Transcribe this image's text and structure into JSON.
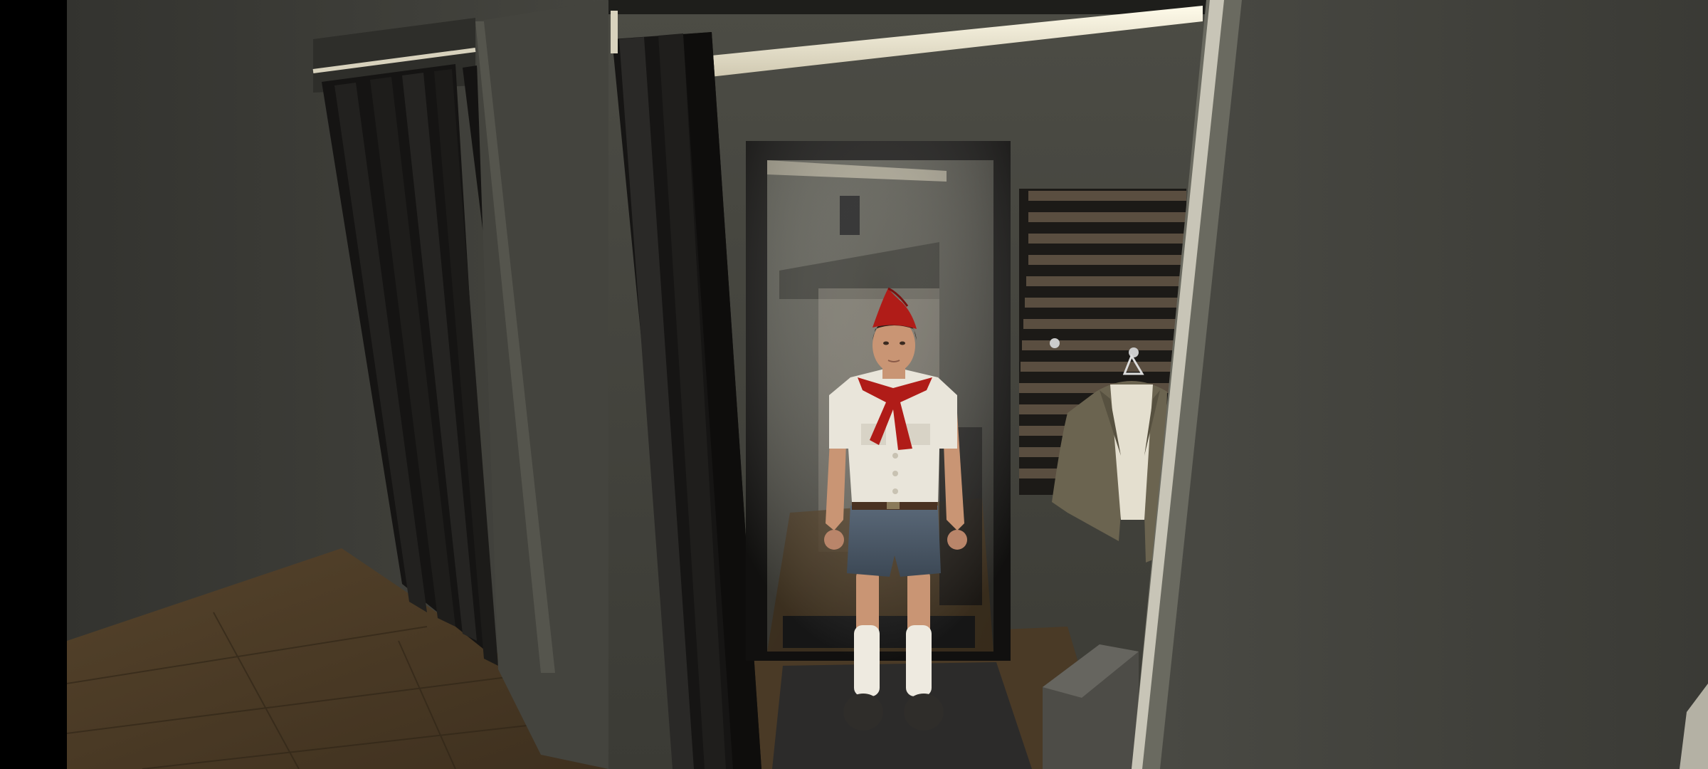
{
  "screen": {
    "type": "game-3d-scene",
    "location": "fitting-room",
    "hud_text": []
  },
  "colors": {
    "wall": "#3d3d38",
    "wall_dark": "#2a2a26",
    "floor_wood": "#4a3a26",
    "curtain": "#1a1918",
    "rail": "#e8e2cc",
    "mirror_frame": "#1d1c1a",
    "scarf_red": "#b01c18",
    "shirt": "#e9e5da",
    "shorts": "#4e5c6a",
    "socks": "#eeeae0",
    "jacket": "#6b6450",
    "skin": "#c99574",
    "hair": "#2a1f18"
  },
  "character": {
    "role": "player-avatar",
    "outfit": [
      "pioneer-cap",
      "red-neckerchief",
      "white-short-sleeve-shirt",
      "brown-belt",
      "blue-shorts",
      "white-knee-socks",
      "dark-shoes"
    ]
  },
  "props": [
    "left-booth-curtain",
    "center-booth-curtain",
    "curtain-rail",
    "standing-mirror",
    "slatted-wall-rack",
    "hanging-jacket",
    "bench",
    "floor-mat"
  ]
}
